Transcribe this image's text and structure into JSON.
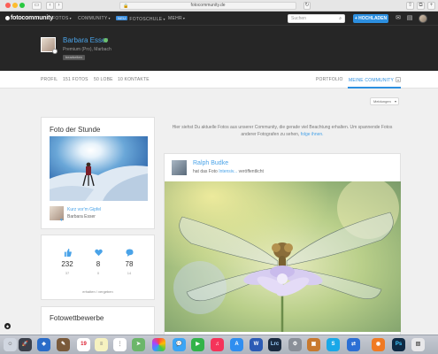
{
  "browser": {
    "url": "fotocommunity.de",
    "back": "‹",
    "forward": "›"
  },
  "site": {
    "logo": "fotocommunity",
    "nav": [
      "FOTOS",
      "COMMUNITY",
      "FOTOSCHULE",
      "MEHR"
    ],
    "nav_badge": "NEU",
    "search_placeholder": "Suchen",
    "upload_label": "+ HOCHLADEN",
    "colors": {
      "accent": "#2c8fe0",
      "header_bg": "#262626",
      "link": "#4aa3e8",
      "online": "#6ec06e"
    }
  },
  "profile": {
    "name": "Barbara Esser",
    "meta": "Premium (Pro), Marbach",
    "tag": "bearbeiten"
  },
  "subnav": {
    "left": [
      "PROFIL",
      "151 FOTOS",
      "50 LOBE",
      "10 KONTAKTE"
    ],
    "right": [
      "PORTFOLIO",
      "MEINE COMMUNITY"
    ]
  },
  "sort": {
    "value": "Meldungen"
  },
  "photo_of_day": {
    "title": "Foto der Stunde",
    "photo_title": "Kurz vor'm Gipfel",
    "author": "Barbara Esser"
  },
  "stats": {
    "items": [
      {
        "icon": "thumbs-up-icon",
        "value": "232",
        "sub": "37"
      },
      {
        "icon": "heart-icon",
        "value": "8",
        "sub": "0"
      },
      {
        "icon": "comment-icon",
        "value": "78",
        "sub": "14"
      }
    ],
    "link": "erhalten / vergeben"
  },
  "intro": {
    "text": "Hier siehst Du aktuelle Fotos aus unserer Community, die gerade viel Beachtung erhalten. Um spannende Fotos anderer Fotografen zu sehen,",
    "link": "folge ihnen."
  },
  "feed": {
    "name": "Ralph Budke",
    "action_prefix": "hat das Foto",
    "action_link": "Intensiv...",
    "action_suffix": "veröffentlicht"
  },
  "competitions": {
    "title": "Fotowettbewerbe"
  },
  "dock": {
    "calendar_day": "19",
    "apps": [
      "finder-icon",
      "launchpad-icon",
      "photos-icon",
      "calendar-icon",
      "notes-icon",
      "reminders-icon",
      "maps-icon",
      "photos-app-icon",
      "messages-icon",
      "facetime-icon",
      "music-icon",
      "appstore-icon",
      "settings-icon",
      "word-icon",
      "lightroom-icon",
      "appstore-badge-icon",
      "box-icon",
      "skype-icon",
      "teamviewer-icon",
      "firefox-icon",
      "photoshop-icon",
      "preview-icon",
      "trash-icon"
    ],
    "word_label": "W",
    "lr_label": "Lrc",
    "skype_label": "S",
    "ps_label": "Ps"
  }
}
